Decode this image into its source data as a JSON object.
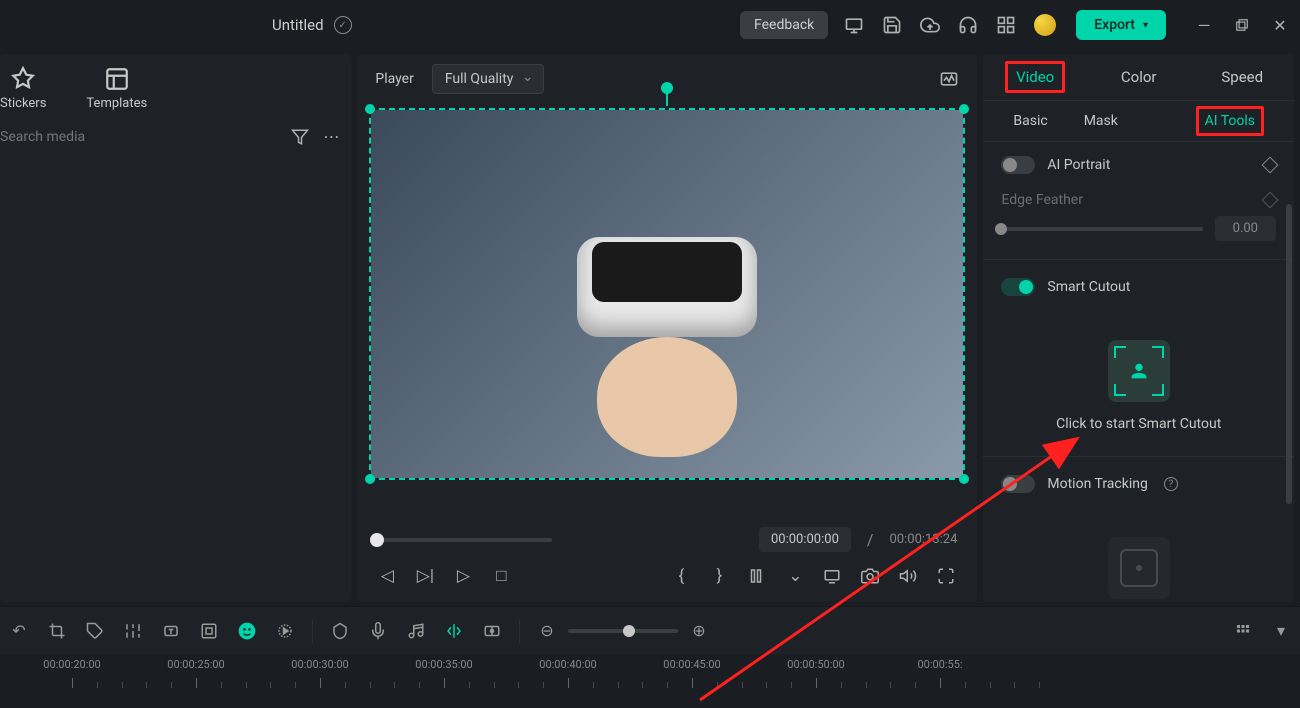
{
  "topbar": {
    "title": "Untitled",
    "feedback": "Feedback",
    "export": "Export"
  },
  "left": {
    "tabs": [
      {
        "label": "Stickers"
      },
      {
        "label": "Templates"
      }
    ],
    "search_placeholder": "Search media"
  },
  "player": {
    "label": "Player",
    "quality": "Full Quality",
    "current_time": "00:00:00:00",
    "separator": "/",
    "total_time": "00:00:13:24"
  },
  "right": {
    "tabs1": [
      "Video",
      "Color",
      "Speed"
    ],
    "tabs2": [
      "Basic",
      "Mask",
      "AI Tools"
    ],
    "ai_portrait": "AI Portrait",
    "edge_feather": "Edge Feather",
    "edge_feather_value": "0.00",
    "smart_cutout": "Smart Cutout",
    "cutout_cta": "Click to start Smart Cutout",
    "motion_tracking": "Motion Tracking"
  },
  "timeline": {
    "labels": [
      "00:00:20:00",
      "00:00:25:00",
      "00:00:30:00",
      "00:00:35:00",
      "00:00:40:00",
      "00:00:45:00",
      "00:00:50:00",
      "00:00:55:"
    ]
  }
}
